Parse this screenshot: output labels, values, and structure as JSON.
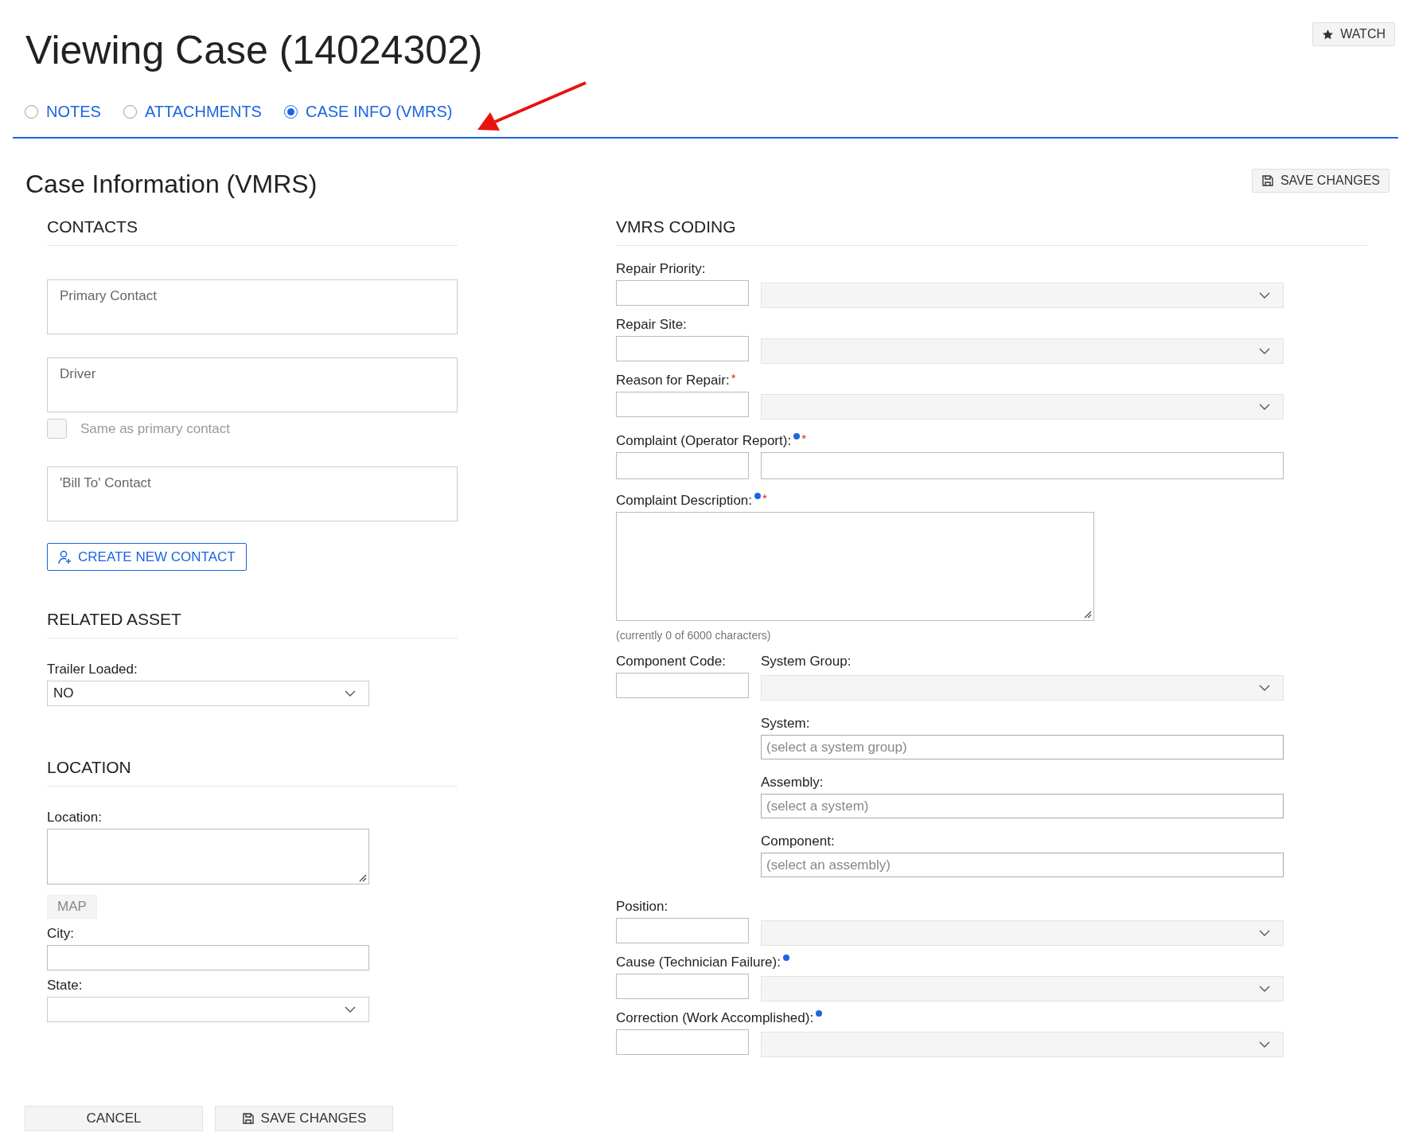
{
  "page": {
    "title": "Viewing Case (14024302)",
    "watch_button": "WATCH"
  },
  "tabs": [
    {
      "label": "NOTES",
      "selected": false
    },
    {
      "label": "ATTACHMENTS",
      "selected": false
    },
    {
      "label": "CASE INFO (VMRS)",
      "selected": true
    }
  ],
  "section": {
    "title": "Case Information (VMRS)",
    "save_button": "SAVE CHANGES"
  },
  "contacts": {
    "heading": "CONTACTS",
    "items": [
      {
        "kind": "field",
        "placeholder": "Primary Contact"
      },
      {
        "kind": "field",
        "placeholder": "Driver"
      },
      {
        "kind": "checkbox",
        "label": "Same as primary contact",
        "checked": false
      },
      {
        "kind": "field",
        "placeholder": "'Bill To' Contact"
      }
    ],
    "create_button": "CREATE NEW CONTACT"
  },
  "related_asset": {
    "heading": "RELATED ASSET",
    "trailer_loaded": {
      "label": "Trailer Loaded:",
      "value": "NO"
    }
  },
  "location": {
    "heading": "LOCATION",
    "location_label": "Location:",
    "map_button": "MAP",
    "city_label": "City:",
    "state_label": "State:"
  },
  "vmrs": {
    "heading": "VMRS CODING",
    "rows": [
      {
        "kind": "select",
        "label": "Repair Priority:",
        "info": false
      },
      {
        "kind": "select",
        "label": "Repair Site:",
        "info": false
      },
      {
        "kind": "select",
        "label": "Reason for Repair:",
        "info": false,
        "required_mark": "*"
      },
      {
        "kind": "text",
        "label": "Complaint (Operator Report):",
        "info": true,
        "required_mark": "*"
      },
      {
        "kind": "textarea",
        "label": "Complaint Description:",
        "info": true,
        "required_mark": "*",
        "hint": "(currently 0 of 6000 characters)"
      },
      {
        "kind": "component",
        "label": "Component Code:",
        "info": false,
        "group_label": "System Group:",
        "chain": [
          {
            "label": "System:",
            "placeholder": "(select a system group)"
          },
          {
            "label": "Assembly:",
            "placeholder": "(select a system)"
          },
          {
            "label": "Component:",
            "placeholder": "(select an assembly)"
          }
        ]
      },
      {
        "kind": "select",
        "label": "Position:",
        "info": false
      },
      {
        "kind": "select",
        "label": "Cause (Technician Failure):",
        "info": true
      },
      {
        "kind": "select",
        "label": "Correction (Work Accomplished):",
        "info": true
      }
    ]
  },
  "footer": {
    "cancel_button": "CANCEL",
    "save_button": "SAVE CHANGES"
  }
}
